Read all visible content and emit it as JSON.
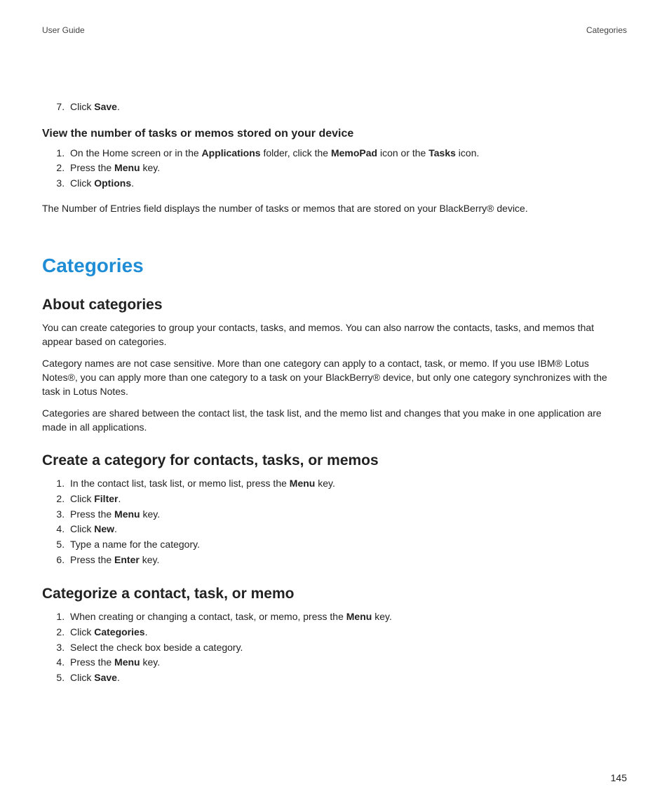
{
  "header": {
    "left": "User Guide",
    "right": "Categories"
  },
  "continued": {
    "start": 7,
    "items": [
      {
        "pre": "Click ",
        "bold": "Save",
        "post": "."
      }
    ]
  },
  "view": {
    "heading": "View the number of tasks or memos stored on your device",
    "steps": [
      {
        "segments": [
          {
            "t": "On the Home screen or in the "
          },
          {
            "t": "Applications",
            "b": true
          },
          {
            "t": " folder, click the "
          },
          {
            "t": "MemoPad",
            "b": true
          },
          {
            "t": " icon or the "
          },
          {
            "t": "Tasks",
            "b": true
          },
          {
            "t": " icon."
          }
        ]
      },
      {
        "segments": [
          {
            "t": "Press the "
          },
          {
            "t": "Menu",
            "b": true
          },
          {
            "t": " key."
          }
        ]
      },
      {
        "segments": [
          {
            "t": "Click "
          },
          {
            "t": "Options",
            "b": true
          },
          {
            "t": "."
          }
        ]
      }
    ],
    "note": "The Number of Entries field displays the number of tasks or memos that are stored on your BlackBerry® device."
  },
  "section_title": "Categories",
  "about": {
    "heading": "About categories",
    "paras": [
      "You can create categories to group your contacts, tasks, and memos. You can also narrow the contacts, tasks, and memos that appear based on categories.",
      "Category names are not case sensitive. More than one category can apply to a contact, task, or memo. If you use IBM® Lotus Notes®, you can apply more than one category to a task on your BlackBerry® device, but only one category synchronizes with the task in Lotus Notes.",
      "Categories are shared between the contact list, the task list, and the memo list and changes that you make in one application are made in all applications."
    ]
  },
  "create": {
    "heading": "Create a category for contacts, tasks, or memos",
    "steps": [
      {
        "segments": [
          {
            "t": "In the contact list, task list, or memo list, press the "
          },
          {
            "t": "Menu",
            "b": true
          },
          {
            "t": " key."
          }
        ]
      },
      {
        "segments": [
          {
            "t": "Click "
          },
          {
            "t": "Filter",
            "b": true
          },
          {
            "t": "."
          }
        ]
      },
      {
        "segments": [
          {
            "t": "Press the "
          },
          {
            "t": "Menu",
            "b": true
          },
          {
            "t": " key."
          }
        ]
      },
      {
        "segments": [
          {
            "t": "Click "
          },
          {
            "t": "New",
            "b": true
          },
          {
            "t": "."
          }
        ]
      },
      {
        "segments": [
          {
            "t": "Type a name for the category."
          }
        ]
      },
      {
        "segments": [
          {
            "t": "Press the "
          },
          {
            "t": "Enter",
            "b": true
          },
          {
            "t": " key."
          }
        ]
      }
    ]
  },
  "categorize": {
    "heading": "Categorize a contact, task, or memo",
    "steps": [
      {
        "segments": [
          {
            "t": "When creating or changing a contact, task, or memo, press the "
          },
          {
            "t": "Menu",
            "b": true
          },
          {
            "t": " key."
          }
        ]
      },
      {
        "segments": [
          {
            "t": "Click "
          },
          {
            "t": "Categories",
            "b": true
          },
          {
            "t": "."
          }
        ]
      },
      {
        "segments": [
          {
            "t": "Select the check box beside a category."
          }
        ]
      },
      {
        "segments": [
          {
            "t": "Press the "
          },
          {
            "t": "Menu",
            "b": true
          },
          {
            "t": " key."
          }
        ]
      },
      {
        "segments": [
          {
            "t": "Click "
          },
          {
            "t": "Save",
            "b": true
          },
          {
            "t": "."
          }
        ]
      }
    ]
  },
  "page_number": "145"
}
